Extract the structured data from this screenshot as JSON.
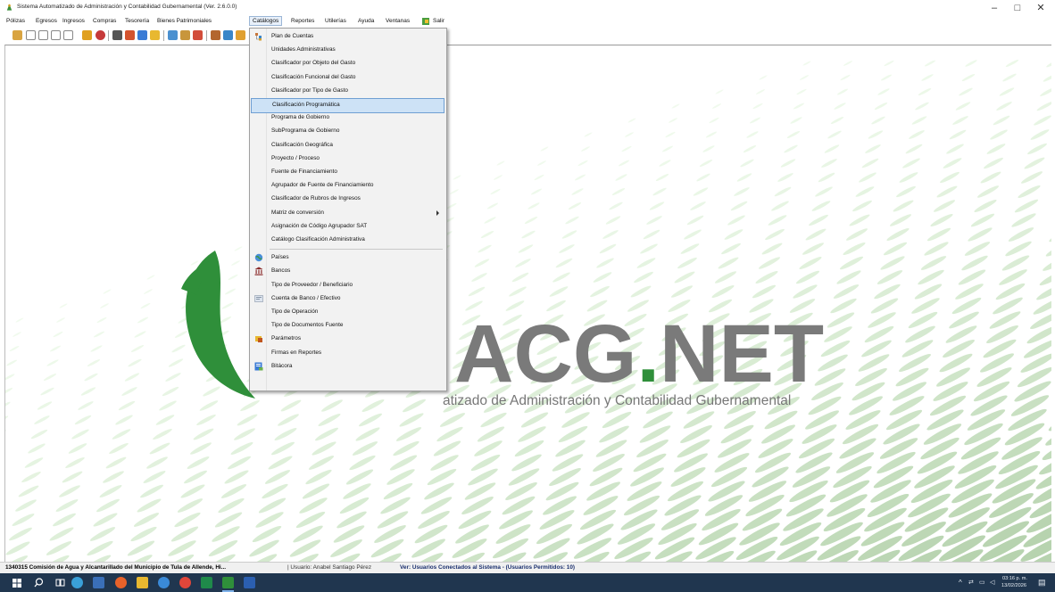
{
  "window": {
    "title": "Sistema Automatizado de Administración y Contabilidad Gubernamental (Ver. 2.6.0.0)",
    "minimize_glyph": "–",
    "maximize_glyph": "□",
    "close_glyph": "✕"
  },
  "menubar": {
    "items": [
      "Pólizas",
      "Egresos",
      "Ingresos",
      "Compras",
      "Tesorería",
      "Bienes Patrimoniales",
      "Catálogos",
      "Reportes",
      "Utilerías",
      "Ayuda",
      "Ventanas",
      "Salir"
    ],
    "active": "Catálogos"
  },
  "catalog_menu": {
    "items": [
      {
        "label": "Plan de Cuentas",
        "icon": "tree-icon"
      },
      {
        "label": "Unidades Administrativas"
      },
      {
        "label": "Clasificador por Objeto del Gasto"
      },
      {
        "label": "Clasificación Funcional del Gasto"
      },
      {
        "label": "Clasificador por Tipo de Gasto"
      },
      {
        "label": "Clasificación Programática",
        "selected": true
      },
      {
        "label": "Programa de Gobierno"
      },
      {
        "label": "SubPrograma de Gobierno"
      },
      {
        "label": "Clasificación Geográfica"
      },
      {
        "label": "Proyecto / Proceso"
      },
      {
        "label": "Fuente de Financiamiento"
      },
      {
        "label": "Agrupador de Fuente de Financiamiento"
      },
      {
        "label": "Clasificador de Rubros de Ingresos"
      },
      {
        "label": "Matriz de conversión",
        "submenu": true
      },
      {
        "label": "Asignación de Código Agrupador SAT"
      },
      {
        "label": "Catálogo Clasificación Administrativa"
      },
      {
        "label": "Países",
        "icon": "globe-icon"
      },
      {
        "label": "Bancos",
        "icon": "bank-icon"
      },
      {
        "label": "Tipo de Proveedor / Beneficiario"
      },
      {
        "label": "Cuenta de Banco / Efectivo",
        "icon": "card-icon"
      },
      {
        "label": "Tipo de Operación"
      },
      {
        "label": "Tipo de Documentos Fuente"
      },
      {
        "label": "Parámetros",
        "icon": "parameters-icon"
      },
      {
        "label": "Firmas en Reportes"
      },
      {
        "label": "Bitácora",
        "icon": "log-icon"
      }
    ]
  },
  "logo": {
    "name_dark": "ACG",
    "name_dot": ".",
    "name_suffix": "NET",
    "subtitle": "atizado de Administración y Contabilidad Gubernamental"
  },
  "status": {
    "entity": "1340315 Comisión de Agua y Alcantarillado del Municipio de Tula de Allende, Hi...",
    "user": "| Usuario: Anabel Santiago Pérez",
    "connected": "Ver: Usuarios Conectados al Sistema - (Usuarios Permitidos: 10)"
  },
  "taskbar": {
    "time": "03:16 p. m.",
    "date": "13/02/2026"
  },
  "colors": {
    "accent_green": "#2f8f3a",
    "logo_gray": "#7a7a7a",
    "taskbar": "#20364f",
    "menu_selection": "#cde2f6"
  }
}
